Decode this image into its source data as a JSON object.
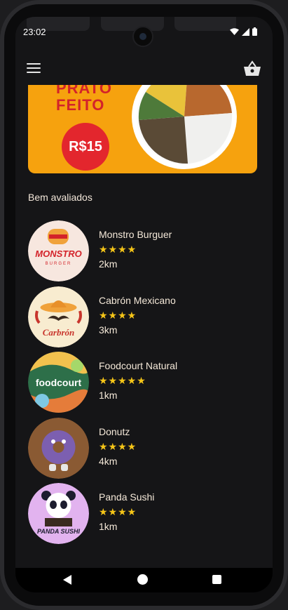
{
  "status_bar": {
    "time": "23:02"
  },
  "banner": {
    "line1": "PRATO",
    "line2": "FEITO",
    "price": "R$15"
  },
  "section": {
    "title": "Bem avaliados"
  },
  "restaurants": [
    {
      "name": "Monstro Burguer",
      "stars": "★★★★",
      "distance": "2km",
      "logo_text": "MONSTRO",
      "logo_sub": "BURGER",
      "bg": "#f7e7df"
    },
    {
      "name": "Cabrón Mexicano",
      "stars": "★★★★",
      "distance": "3km",
      "logo_text": "Carbrón",
      "bg": "#f8ecd0"
    },
    {
      "name": "Foodcourt Natural",
      "stars": "★★★★★",
      "distance": "1km",
      "logo_text": "foodcourt",
      "bg": "#2d6f49"
    },
    {
      "name": "Donutz",
      "stars": "★★★★",
      "distance": "4km",
      "logo_text": "",
      "bg": "#8a5a33"
    },
    {
      "name": "Panda Sushi",
      "stars": "★★★★",
      "distance": "1km",
      "logo_text": "PANDA SUSHI",
      "bg": "#e2b3ef"
    }
  ],
  "icons": {
    "menu": "menu-icon",
    "basket": "basket-icon",
    "back": "back-icon",
    "home": "home-icon",
    "recents": "recents-icon"
  },
  "colors": {
    "background": "#151517",
    "accent_star": "#f5c518",
    "banner_bg": "#f6a20e",
    "banner_red": "#d3232a",
    "text": "#f4e8d8"
  }
}
